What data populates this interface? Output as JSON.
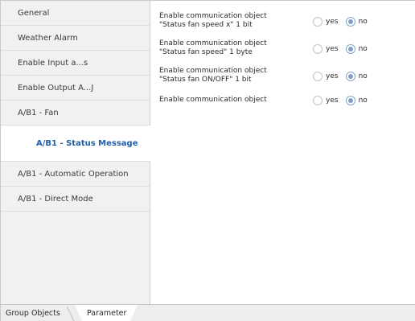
{
  "sidebar": {
    "items": [
      {
        "label": "General"
      },
      {
        "label": "Weather Alarm"
      },
      {
        "label": "Enable Input a...s"
      },
      {
        "label": "Enable Output A...J"
      },
      {
        "label": "A/B1 - Fan"
      },
      {
        "label": "A/B1 - Status Message",
        "active": true
      },
      {
        "label": "A/B1 - Automatic Operation"
      },
      {
        "label": "A/B1 - Direct Mode"
      }
    ]
  },
  "params": [
    {
      "line1": "Enable communication object",
      "line2": "\"Status fan speed x\" 1 bit",
      "options": [
        "yes",
        "no"
      ],
      "selected": "no"
    },
    {
      "line1": "Enable communication object",
      "line2": "\"Status fan speed\" 1 byte",
      "options": [
        "yes",
        "no"
      ],
      "selected": "no"
    },
    {
      "line1": "Enable communication object",
      "line2": "\"Status fan ON/OFF\" 1 bit",
      "options": [
        "yes",
        "no"
      ],
      "selected": "no"
    },
    {
      "line1": "Enable communication object",
      "line2": "",
      "options": [
        "yes",
        "no"
      ],
      "selected": "no"
    }
  ],
  "tabs": {
    "group_objects": "Group Objects",
    "parameter": "Parameter",
    "active": "parameter"
  },
  "colors": {
    "active_nav_text": "#1f5fa8",
    "sidebar_bg": "#f1f1f1",
    "radio_selected": "#7f9fc8"
  }
}
